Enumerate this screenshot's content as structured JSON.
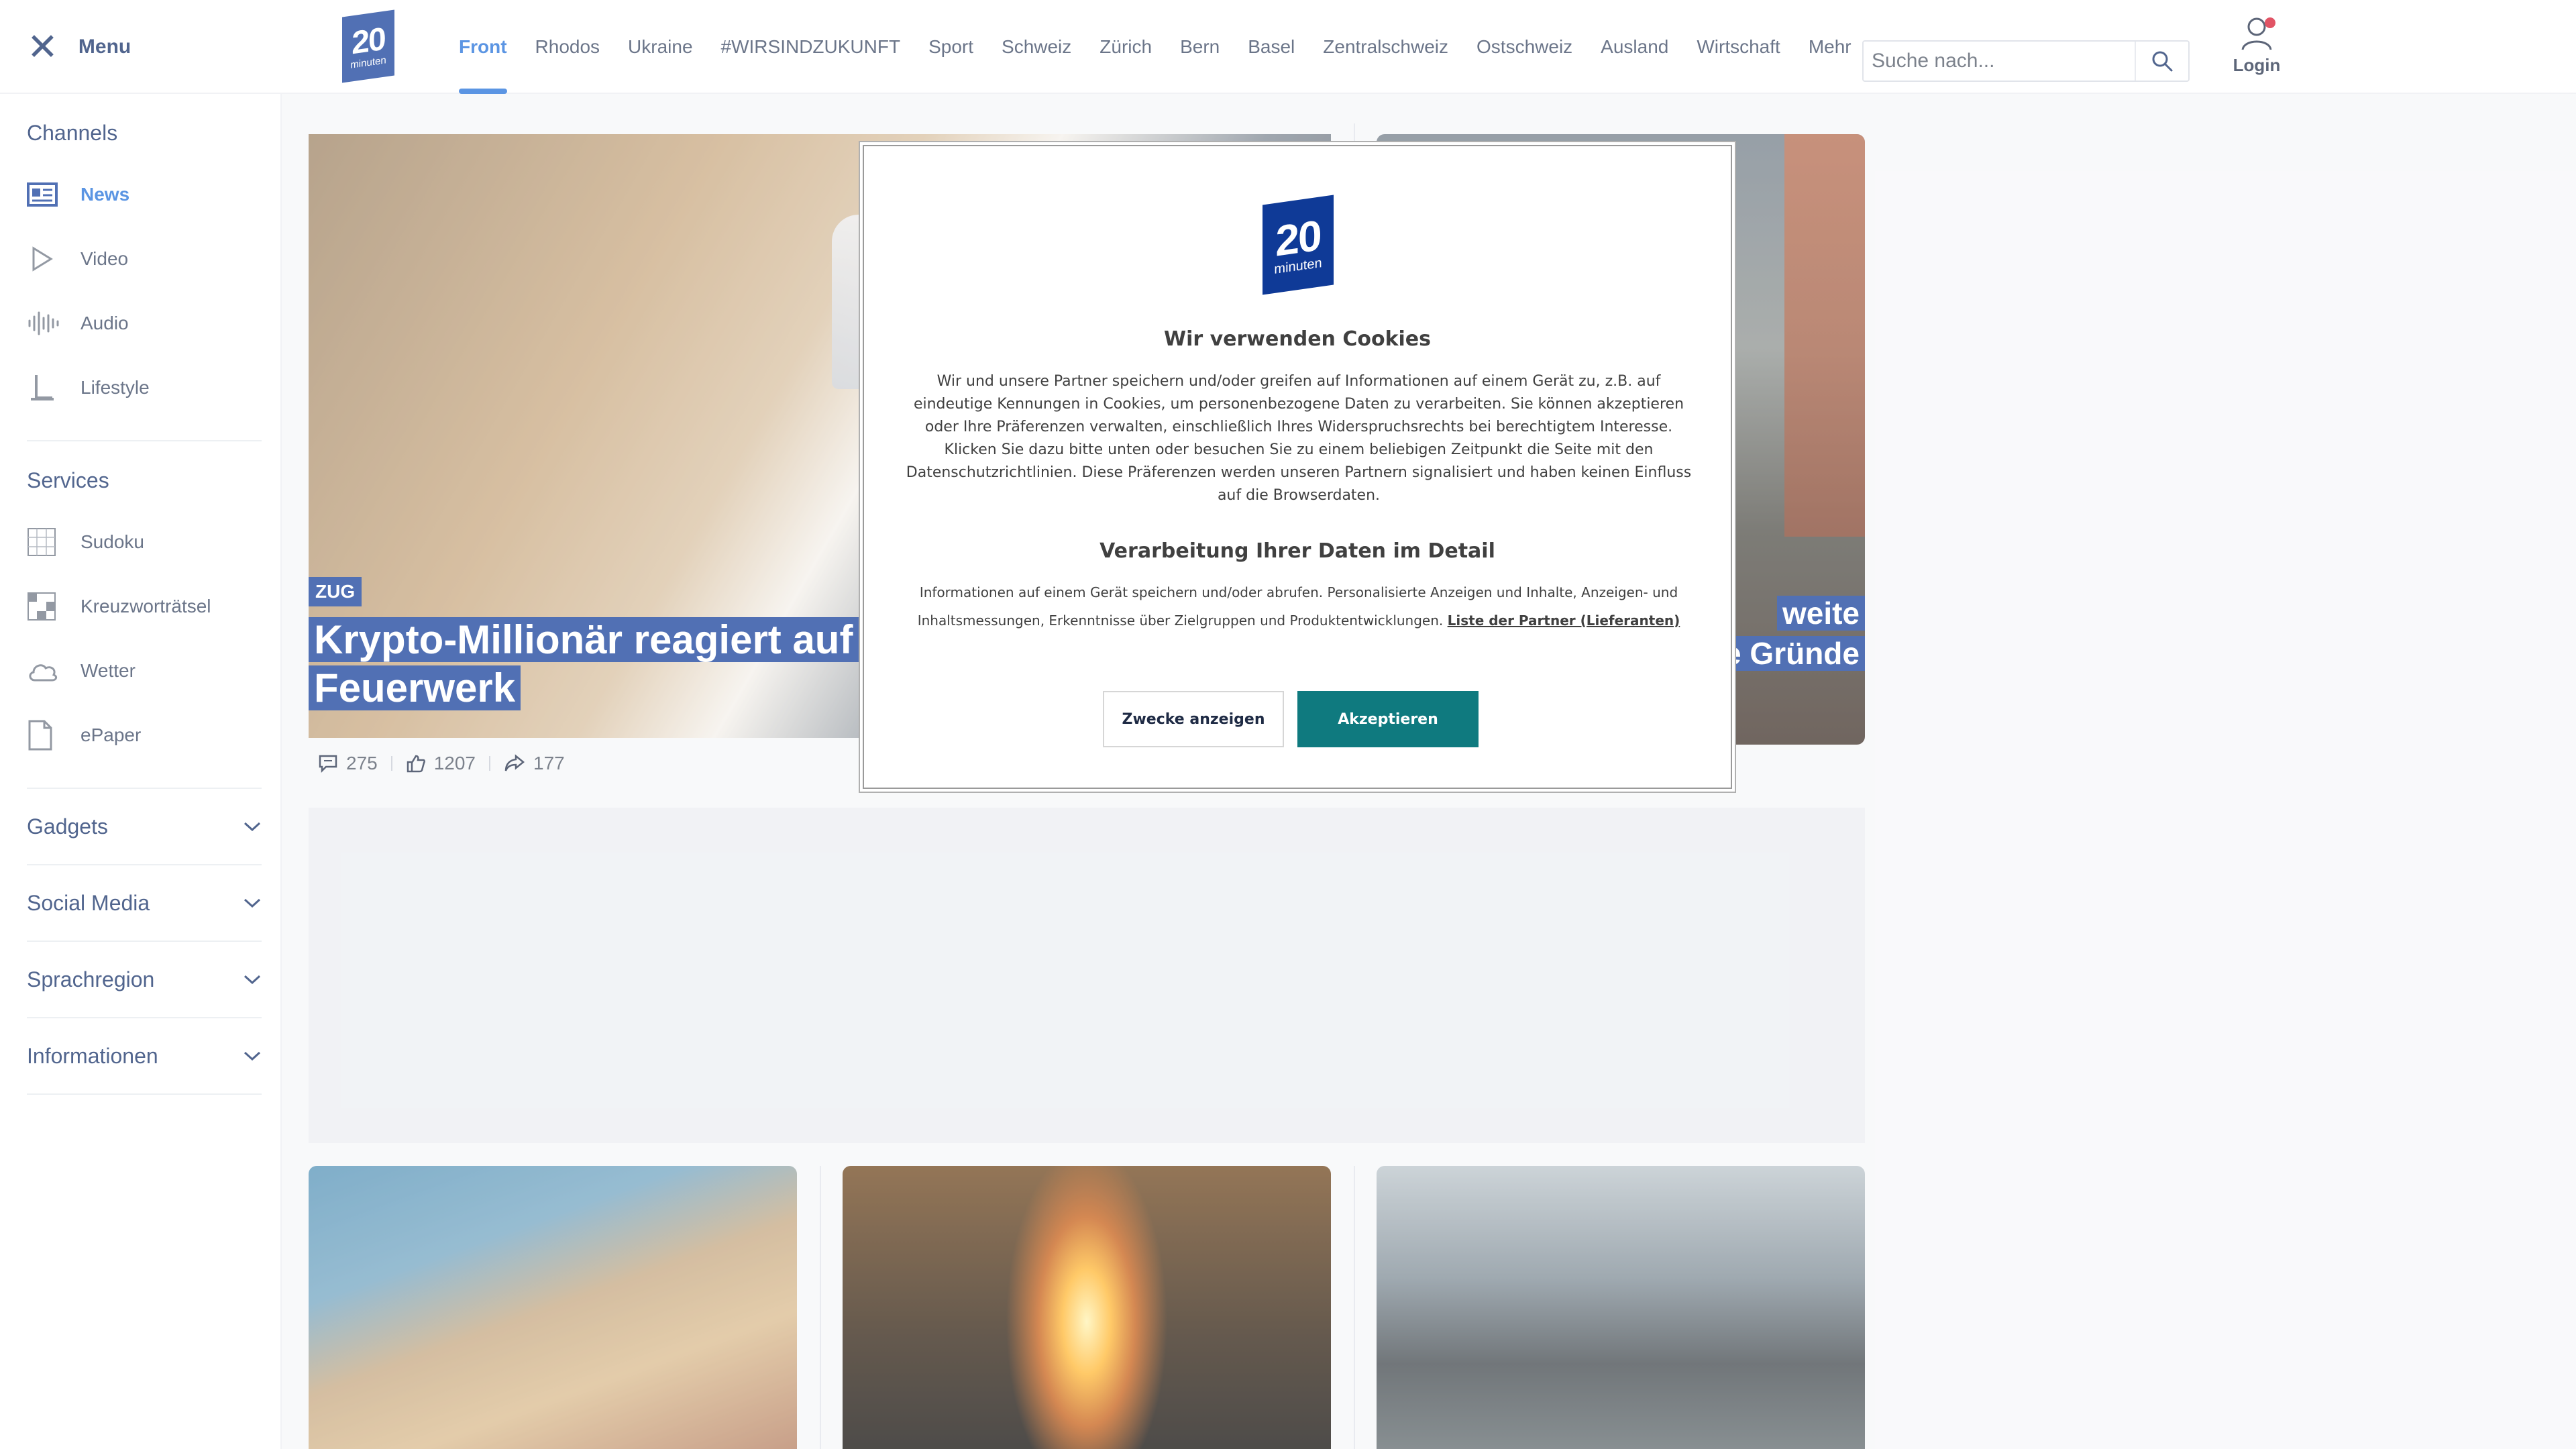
{
  "header": {
    "menu_label": "Menu",
    "logo": {
      "number": "20",
      "sub": "minuten"
    },
    "tabs": [
      "Front",
      "Rhodos",
      "Ukraine",
      "#WIRSINDZUKUNFT",
      "Sport",
      "Schweiz",
      "Zürich",
      "Bern",
      "Basel",
      "Zentralschweiz",
      "Ostschweiz",
      "Ausland",
      "Wirtschaft",
      "Mehr"
    ],
    "active_tab": "Front",
    "search_placeholder": "Suche nach...",
    "login_label": "Login"
  },
  "sidebar": {
    "channels_title": "Channels",
    "channels": [
      {
        "label": "News",
        "icon": "news-icon",
        "active": true
      },
      {
        "label": "Video",
        "icon": "play-icon"
      },
      {
        "label": "Audio",
        "icon": "audio-waveform-icon"
      },
      {
        "label": "Lifestyle",
        "icon": "lifestyle-icon"
      }
    ],
    "services_title": "Services",
    "services": [
      {
        "label": "Sudoku",
        "icon": "sudoku-icon"
      },
      {
        "label": "Kreuzworträtsel",
        "icon": "crossword-icon"
      },
      {
        "label": "Wetter",
        "icon": "cloud-icon"
      },
      {
        "label": "ePaper",
        "icon": "document-icon"
      }
    ],
    "accordions": [
      "Gadgets",
      "Social Media",
      "Sprachregion",
      "Informationen"
    ]
  },
  "main": {
    "hero": {
      "kicker": "ZUG",
      "headline_line1": "Krypto-Millionär reagiert auf Kr",
      "headline_line2": "Feuerwerk",
      "stats": {
        "comments": "275",
        "reactions": "1207",
        "shares": "177"
      }
    },
    "right_hero": {
      "headline_line1": "weite",
      "headline_line2": "ie Gründe"
    }
  },
  "cookie_dialog": {
    "logo": {
      "number": "20",
      "sub": "minuten"
    },
    "title": "Wir verwenden Cookies",
    "body": "Wir und unsere Partner speichern und/oder greifen auf Informationen auf einem Gerät zu, z.B. auf eindeutige Kennungen in Cookies, um personenbezogene Daten zu verarbeiten. Sie können akzeptieren oder Ihre Präferenzen verwalten, einschließlich Ihres Widerspruchsrechts bei berechtigtem Interesse. Klicken Sie dazu bitte unten oder besuchen Sie zu einem beliebigen Zeitpunkt die Seite mit den Datenschutzrichtlinien. Diese Präferenzen werden unseren Partnern signalisiert und haben keinen Einfluss auf die Browserdaten.",
    "detail_title": "Verarbeitung Ihrer Daten im Detail",
    "detail_text": "Informationen auf einem Gerät speichern und/oder abrufen. Personalisierte Anzeigen und Inhalte, Anzeigen- und Inhaltsmessungen, Erkenntnisse über Zielgruppen und Produktentwicklungen.",
    "partner_link": "Liste der Partner (Lieferanten)",
    "btn_secondary": "Zwecke anzeigen",
    "btn_primary": "Akzeptieren"
  },
  "colors": {
    "brand_blue": "#0f3a97",
    "nav_active": "#1d6cd8",
    "accept_teal": "#0f7a7f",
    "notification_red": "#d6122a"
  }
}
